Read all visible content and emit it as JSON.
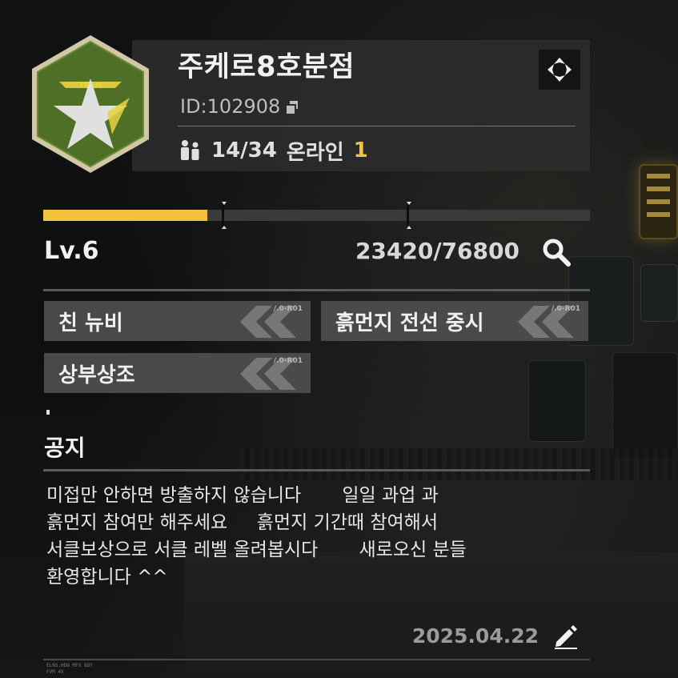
{
  "club": {
    "name": "주케로8호분점",
    "id_label": "ID:",
    "id_value": "102908",
    "member_count": "14/34",
    "online_label": "온라인",
    "online_count": "1",
    "badge_text": "TECH"
  },
  "progress": {
    "level": "Lv.6",
    "xp_text": "23420/76800",
    "xp_current": 23420,
    "xp_max": 76800,
    "fill_fraction": 0.3
  },
  "tags": [
    {
      "label": "친 뉴비",
      "code": "/.0-R01"
    },
    {
      "label": "흙먼지 전선 중시",
      "code": "/.0-R01"
    },
    {
      "label": "상부상조",
      "code": "/.0-R01"
    }
  ],
  "notice": {
    "title": "공지",
    "body": "미접만 안하면 방출하지 않습니다       일일 과업 과\n흙먼지 참여만 해주세요     흙먼지 기간때 참여해서\n서클보상으로 서클 레벨 올려봅시다       새로오신 분들\n환영합니다 ^^",
    "date": "2025.04.22"
  },
  "footer": {
    "line1": "ELNS.HDN MFX 8DY",
    "line2": "FVM 4X"
  },
  "colors": {
    "accent": "#f2c23e",
    "card_bg": "#2c2c2c",
    "tag_bg": "#4e4e50",
    "badge_green": "#5a7a2c"
  },
  "icons": {
    "copy": "copy-icon",
    "members": "members-icon",
    "target": "crosshair-icon",
    "search": "search-icon",
    "edit": "pencil-icon"
  }
}
